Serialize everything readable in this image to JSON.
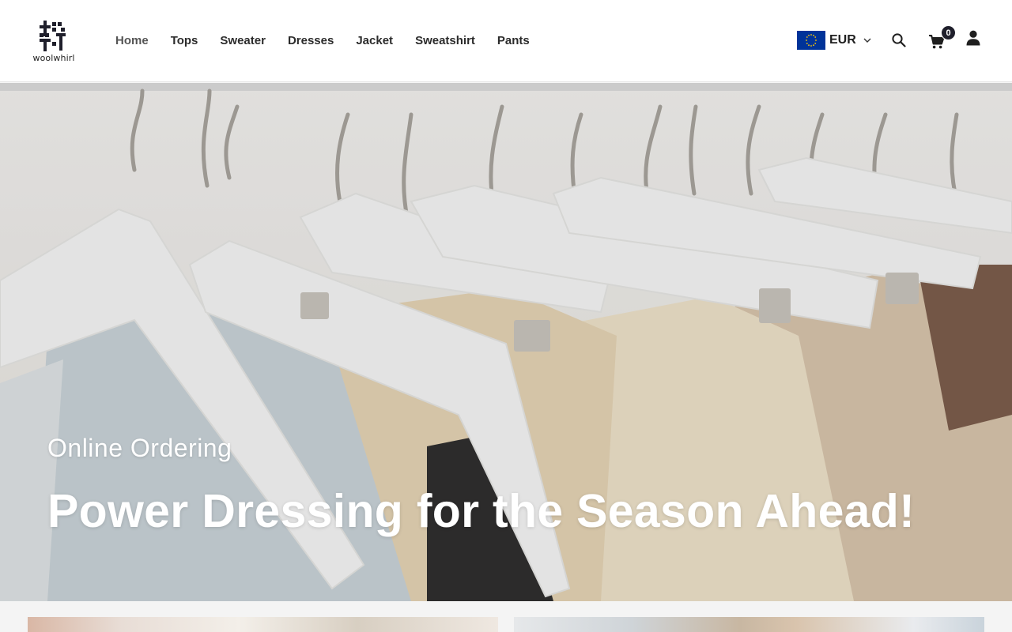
{
  "brand": {
    "name": "woolwhirl"
  },
  "nav": {
    "items": [
      {
        "label": "Home",
        "active": true
      },
      {
        "label": "Tops"
      },
      {
        "label": "Sweater"
      },
      {
        "label": "Dresses"
      },
      {
        "label": "Jacket"
      },
      {
        "label": "Sweatshirt"
      },
      {
        "label": "Pants"
      }
    ]
  },
  "currency": {
    "code": "EUR",
    "flag": "eu-flag-icon"
  },
  "header_icons": {
    "search": "search-icon",
    "cart": "cart-icon",
    "account": "user-icon"
  },
  "cart": {
    "count": "0"
  },
  "hero": {
    "subtitle": "Online Ordering",
    "title": "Power Dressing for the Season Ahead!"
  },
  "colors": {
    "header_bg": "#ffffff",
    "text_dark": "#1f1f1f",
    "badge_bg": "#1f1f2b",
    "hero_text": "#ffffff",
    "flag_blue": "#003399",
    "flag_star": "#ffcc00"
  }
}
